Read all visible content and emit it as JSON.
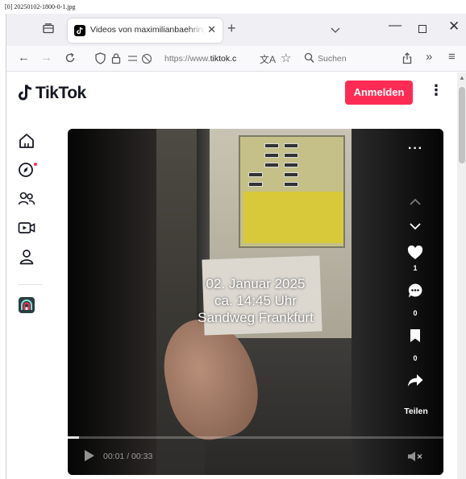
{
  "image_caption": "[0] 20250102-1800-0-1.jpg",
  "browser": {
    "tab_title": "Videos von maximilianbaehring",
    "address_url_prefix": "https://www.",
    "address_url_host": "tiktok.c",
    "search_placeholder": "Suchen"
  },
  "tiktok": {
    "logo_text": "TikTok",
    "login_label": "Anmelden",
    "more_label": "⋮",
    "nav_items": [
      "for-you",
      "explore",
      "following",
      "live",
      "profile",
      "creator"
    ]
  },
  "video": {
    "overlay_lines": [
      "02. Januar 2025",
      "ca. 14:45 Uhr",
      "Sandweg Frankfurt"
    ],
    "likes": "1",
    "comments": "0",
    "saves": "0",
    "share_label": "Teilen",
    "time": "00:01 / 00:33",
    "progress": 0.03
  },
  "colors": {
    "accent": "#fe2c55",
    "video_bg": "#0d0d0d"
  }
}
